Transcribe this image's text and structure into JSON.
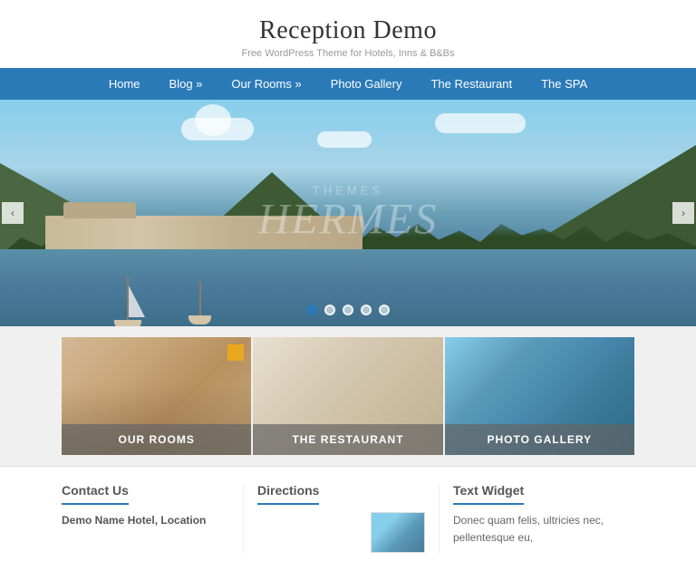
{
  "site": {
    "title": "Reception Demo",
    "subtitle": "Free WordPress Theme for Hotels, Inns & B&Bs"
  },
  "nav": {
    "items": [
      {
        "label": "Home",
        "has_submenu": false
      },
      {
        "label": "Blog »",
        "has_submenu": true
      },
      {
        "label": "Our Rooms »",
        "has_submenu": true
      },
      {
        "label": "Photo Gallery",
        "has_submenu": false
      },
      {
        "label": "The Restaurant",
        "has_submenu": false
      },
      {
        "label": "The SPA",
        "has_submenu": false
      }
    ]
  },
  "slider": {
    "dots": [
      {
        "active": true
      },
      {
        "active": false
      },
      {
        "active": false
      },
      {
        "active": false
      },
      {
        "active": false
      }
    ],
    "watermark_top": "THEMES",
    "watermark_main": "Hermes"
  },
  "feature_cards": [
    {
      "label": "OUR ROOMS"
    },
    {
      "label": "THE RESTAURANT"
    },
    {
      "label": "PHOTO GALLERY"
    }
  ],
  "widgets": [
    {
      "title": "Contact Us",
      "hotel_name": "Demo Name Hotel, Location"
    },
    {
      "title": "Directions"
    },
    {
      "title": "Text Widget",
      "text": "Donec quam felis, ultricies nec, pellentesque eu,"
    }
  ]
}
